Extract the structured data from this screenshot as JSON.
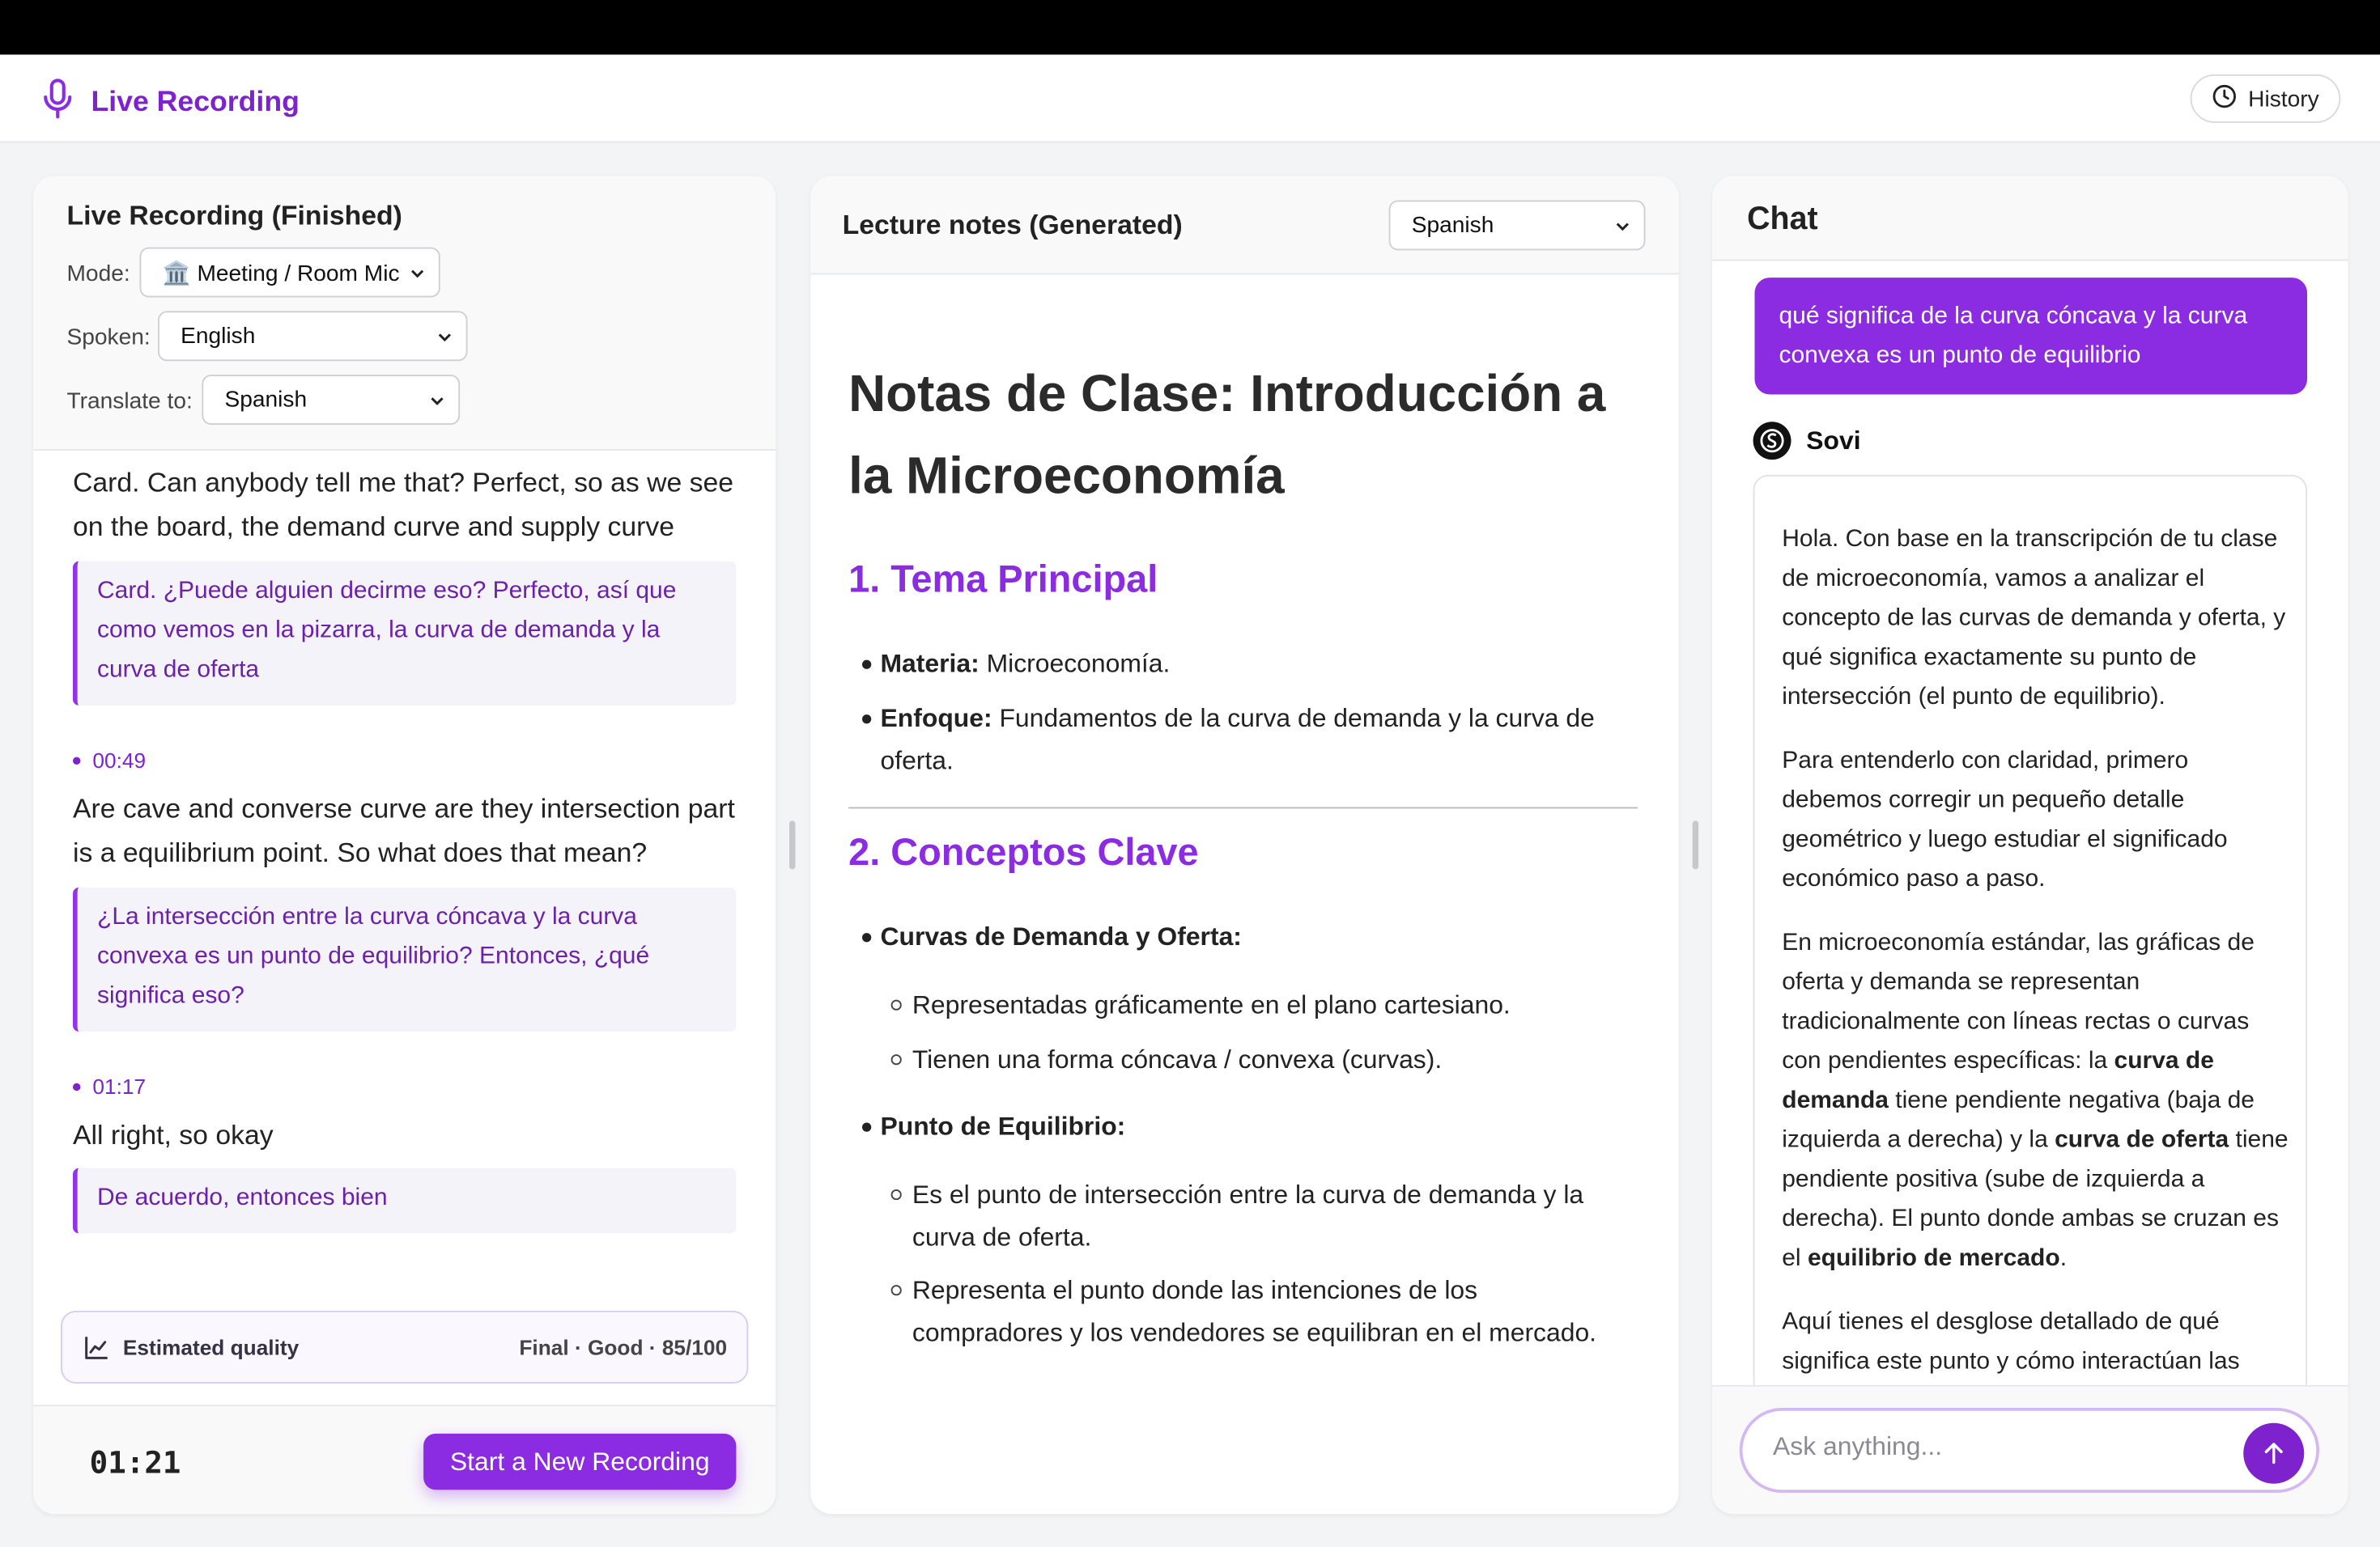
{
  "app": {
    "title": "Live Recording",
    "history_label": "History"
  },
  "left": {
    "title": "Live Recording (Finished)",
    "mode_label": "Mode:",
    "mode_value": "🏛️ Meeting / Room Mic",
    "spoken_label": "Spoken:",
    "spoken_value": "English",
    "translate_label": "Translate to:",
    "translate_value": "Spanish",
    "segments": [
      {
        "time": "",
        "text": "Card. Can anybody tell me that? Perfect, so as we see on the board, the demand curve and supply curve",
        "translation": "Card. ¿Puede alguien decirme eso? Perfecto, así que como vemos en la pizarra, la curva de demanda y la curva de oferta"
      },
      {
        "time": "00:49",
        "text": "Are cave and converse curve are they intersection part is a equilibrium point. So what does that mean?",
        "translation": "¿La intersección entre la curva cóncava y la curva convexa es un punto de equilibrio? Entonces, ¿qué significa eso?"
      },
      {
        "time": "01:17",
        "text": "All right, so okay",
        "translation": "De acuerdo, entonces bien"
      }
    ],
    "quality_label": "Estimated quality",
    "quality_value": "Final · Good · 85/100",
    "timer": "01:21",
    "new_recording_label": "Start a New Recording"
  },
  "notes": {
    "title": "Lecture notes (Generated)",
    "language": "Spanish",
    "h1": "Notas de Clase: Introducción a la Microeconomía",
    "section1": "1. Tema Principal",
    "s1_items": [
      {
        "bold": "Materia:",
        "text": " Microeconomía."
      },
      {
        "bold": "Enfoque:",
        "text": " Fundamentos de la curva de demanda y la curva de oferta."
      }
    ],
    "section2": "2. Conceptos Clave",
    "s2_item1": "Curvas de Demanda y Oferta:",
    "s2_item1_sub": [
      "Representadas gráficamente en el plano cartesiano.",
      "Tienen una forma cóncava / convexa (curvas)."
    ],
    "s2_item2": "Punto de Equilibrio:",
    "s2_item2_sub": [
      "Es el punto de intersección entre la curva de demanda y la curva de oferta.",
      "Representa el punto donde las intenciones de los compradores y los vendedores se equilibran en el mercado."
    ]
  },
  "chat": {
    "title": "Chat",
    "user_message": "qué significa de la curva cóncava y la curva convexa es un punto de equilibrio",
    "bot_name": "Sovi",
    "bot_p1": "Hola. Con base en la transcripción de tu clase de microeconomía, vamos a analizar el concepto de las curvas de demanda y oferta, y qué significa exactamente su punto de intersección (el punto de equilibrio).",
    "bot_p2": "Para entenderlo con claridad, primero debemos corregir un pequeño detalle geométrico y luego estudiar el significado económico paso a paso.",
    "bot_p3_a": "En microeconomía estándar, las gráficas de oferta y demanda se representan tradicionalmente con líneas rectas o curvas con pendientes específicas: la ",
    "bot_p3_b": "curva de demanda",
    "bot_p3_c": " tiene pendiente negativa (baja de izquierda a derecha) y la ",
    "bot_p3_d": "curva de oferta",
    "bot_p3_e": " tiene pendiente positiva (sube de izquierda a derecha). El punto donde ambas se cruzan es el ",
    "bot_p3_f": "equilibrio de mercado",
    "bot_p3_g": ".",
    "bot_p4": "Aquí tienes el desglose detallado de qué significa este punto y cómo interactúan las",
    "input_placeholder": "Ask anything..."
  },
  "colors": {
    "accent": "#8b2be2",
    "accent_dark": "#7e22ce",
    "translation_text": "#6b21a8"
  }
}
